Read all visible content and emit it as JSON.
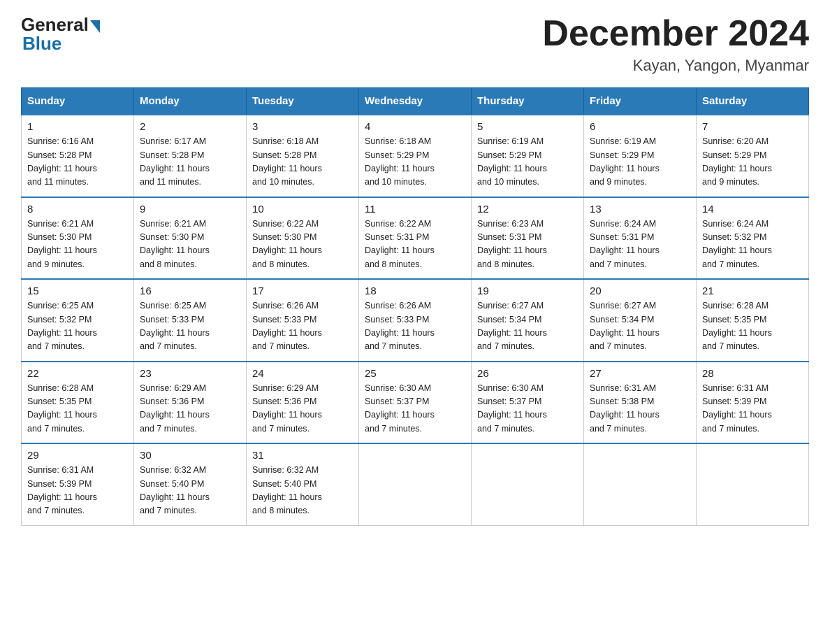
{
  "logo": {
    "general": "General",
    "blue": "Blue"
  },
  "title": "December 2024",
  "subtitle": "Kayan, Yangon, Myanmar",
  "days_of_week": [
    "Sunday",
    "Monday",
    "Tuesday",
    "Wednesday",
    "Thursday",
    "Friday",
    "Saturday"
  ],
  "weeks": [
    [
      {
        "day": "1",
        "sunrise": "6:16 AM",
        "sunset": "5:28 PM",
        "daylight": "11 hours and 11 minutes."
      },
      {
        "day": "2",
        "sunrise": "6:17 AM",
        "sunset": "5:28 PM",
        "daylight": "11 hours and 11 minutes."
      },
      {
        "day": "3",
        "sunrise": "6:18 AM",
        "sunset": "5:28 PM",
        "daylight": "11 hours and 10 minutes."
      },
      {
        "day": "4",
        "sunrise": "6:18 AM",
        "sunset": "5:29 PM",
        "daylight": "11 hours and 10 minutes."
      },
      {
        "day": "5",
        "sunrise": "6:19 AM",
        "sunset": "5:29 PM",
        "daylight": "11 hours and 10 minutes."
      },
      {
        "day": "6",
        "sunrise": "6:19 AM",
        "sunset": "5:29 PM",
        "daylight": "11 hours and 9 minutes."
      },
      {
        "day": "7",
        "sunrise": "6:20 AM",
        "sunset": "5:29 PM",
        "daylight": "11 hours and 9 minutes."
      }
    ],
    [
      {
        "day": "8",
        "sunrise": "6:21 AM",
        "sunset": "5:30 PM",
        "daylight": "11 hours and 9 minutes."
      },
      {
        "day": "9",
        "sunrise": "6:21 AM",
        "sunset": "5:30 PM",
        "daylight": "11 hours and 8 minutes."
      },
      {
        "day": "10",
        "sunrise": "6:22 AM",
        "sunset": "5:30 PM",
        "daylight": "11 hours and 8 minutes."
      },
      {
        "day": "11",
        "sunrise": "6:22 AM",
        "sunset": "5:31 PM",
        "daylight": "11 hours and 8 minutes."
      },
      {
        "day": "12",
        "sunrise": "6:23 AM",
        "sunset": "5:31 PM",
        "daylight": "11 hours and 8 minutes."
      },
      {
        "day": "13",
        "sunrise": "6:24 AM",
        "sunset": "5:31 PM",
        "daylight": "11 hours and 7 minutes."
      },
      {
        "day": "14",
        "sunrise": "6:24 AM",
        "sunset": "5:32 PM",
        "daylight": "11 hours and 7 minutes."
      }
    ],
    [
      {
        "day": "15",
        "sunrise": "6:25 AM",
        "sunset": "5:32 PM",
        "daylight": "11 hours and 7 minutes."
      },
      {
        "day": "16",
        "sunrise": "6:25 AM",
        "sunset": "5:33 PM",
        "daylight": "11 hours and 7 minutes."
      },
      {
        "day": "17",
        "sunrise": "6:26 AM",
        "sunset": "5:33 PM",
        "daylight": "11 hours and 7 minutes."
      },
      {
        "day": "18",
        "sunrise": "6:26 AM",
        "sunset": "5:33 PM",
        "daylight": "11 hours and 7 minutes."
      },
      {
        "day": "19",
        "sunrise": "6:27 AM",
        "sunset": "5:34 PM",
        "daylight": "11 hours and 7 minutes."
      },
      {
        "day": "20",
        "sunrise": "6:27 AM",
        "sunset": "5:34 PM",
        "daylight": "11 hours and 7 minutes."
      },
      {
        "day": "21",
        "sunrise": "6:28 AM",
        "sunset": "5:35 PM",
        "daylight": "11 hours and 7 minutes."
      }
    ],
    [
      {
        "day": "22",
        "sunrise": "6:28 AM",
        "sunset": "5:35 PM",
        "daylight": "11 hours and 7 minutes."
      },
      {
        "day": "23",
        "sunrise": "6:29 AM",
        "sunset": "5:36 PM",
        "daylight": "11 hours and 7 minutes."
      },
      {
        "day": "24",
        "sunrise": "6:29 AM",
        "sunset": "5:36 PM",
        "daylight": "11 hours and 7 minutes."
      },
      {
        "day": "25",
        "sunrise": "6:30 AM",
        "sunset": "5:37 PM",
        "daylight": "11 hours and 7 minutes."
      },
      {
        "day": "26",
        "sunrise": "6:30 AM",
        "sunset": "5:37 PM",
        "daylight": "11 hours and 7 minutes."
      },
      {
        "day": "27",
        "sunrise": "6:31 AM",
        "sunset": "5:38 PM",
        "daylight": "11 hours and 7 minutes."
      },
      {
        "day": "28",
        "sunrise": "6:31 AM",
        "sunset": "5:39 PM",
        "daylight": "11 hours and 7 minutes."
      }
    ],
    [
      {
        "day": "29",
        "sunrise": "6:31 AM",
        "sunset": "5:39 PM",
        "daylight": "11 hours and 7 minutes."
      },
      {
        "day": "30",
        "sunrise": "6:32 AM",
        "sunset": "5:40 PM",
        "daylight": "11 hours and 7 minutes."
      },
      {
        "day": "31",
        "sunrise": "6:32 AM",
        "sunset": "5:40 PM",
        "daylight": "11 hours and 8 minutes."
      },
      null,
      null,
      null,
      null
    ]
  ],
  "labels": {
    "sunrise": "Sunrise:",
    "sunset": "Sunset:",
    "daylight": "Daylight:"
  }
}
